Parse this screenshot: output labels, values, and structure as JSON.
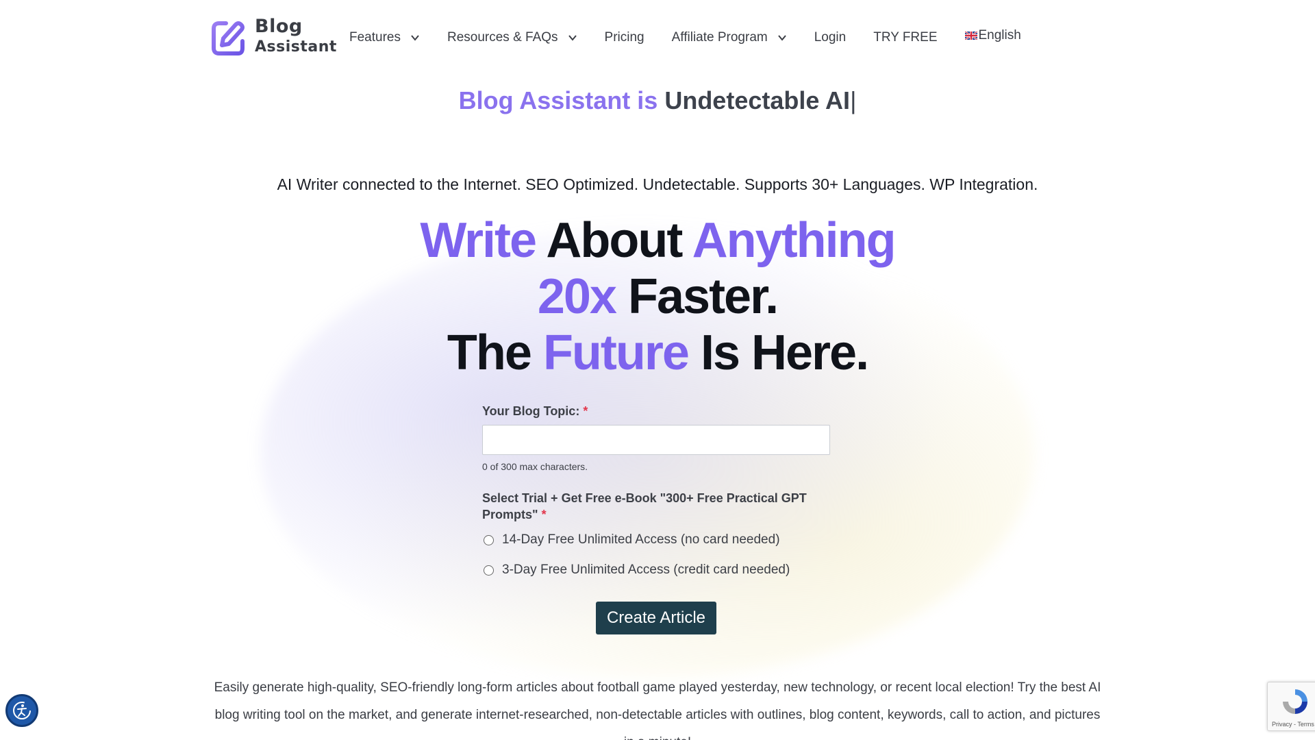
{
  "brand": {
    "line1": "Blog",
    "line2": "Assistant",
    "accent_color": "#8a72ee"
  },
  "nav": {
    "items": [
      {
        "label": "Features",
        "has_dropdown": true
      },
      {
        "label": "Resources & FAQs",
        "has_dropdown": true
      },
      {
        "label": "Pricing",
        "has_dropdown": false
      },
      {
        "label": "Affiliate Program",
        "has_dropdown": true
      },
      {
        "label": "Login",
        "has_dropdown": false
      },
      {
        "label": "TRY FREE",
        "has_dropdown": false
      }
    ],
    "language": {
      "label": "English",
      "icon": "uk-flag-icon"
    }
  },
  "tagline": {
    "prefix": "Blog Assistant is",
    "typed": "Undetectable AI",
    "cursor": "|"
  },
  "subline": "AI Writer connected to the Internet. SEO Optimized. Undetectable. Supports 30+ Languages. WP Integration.",
  "hero": {
    "w1": "Write",
    "w2": "About",
    "w3": "Anything",
    "w4": "20x",
    "w5": "Faster.",
    "w6": "The",
    "w7": "Future",
    "w8": "Is Here."
  },
  "form": {
    "topic_label": "Your Blog Topic:",
    "required_mark": "*",
    "topic_value": "",
    "char_hint": "0 of 300 max characters.",
    "trial_label": "Select Trial + Get Free e-Book \"300+ Free Practical GPT Prompts\"",
    "options": [
      {
        "label": "14-Day Free Unlimited Access (no card needed)",
        "selected": false
      },
      {
        "label": "3-Day Free Unlimited Access (credit card needed)",
        "selected": false
      }
    ],
    "submit_label": "Create Article"
  },
  "description": "Easily generate high-quality, SEO-friendly long-form articles about football game played yesterday, new technology, or recent local election! Try the best AI blog writing tool on the market, and generate internet-researched, non-detectable articles with outlines, blog content, keywords, call to action, and pictures in a minute!",
  "widgets": {
    "accessibility_icon": "accessibility-icon",
    "recaptcha_text": "Privacy - Terms"
  }
}
